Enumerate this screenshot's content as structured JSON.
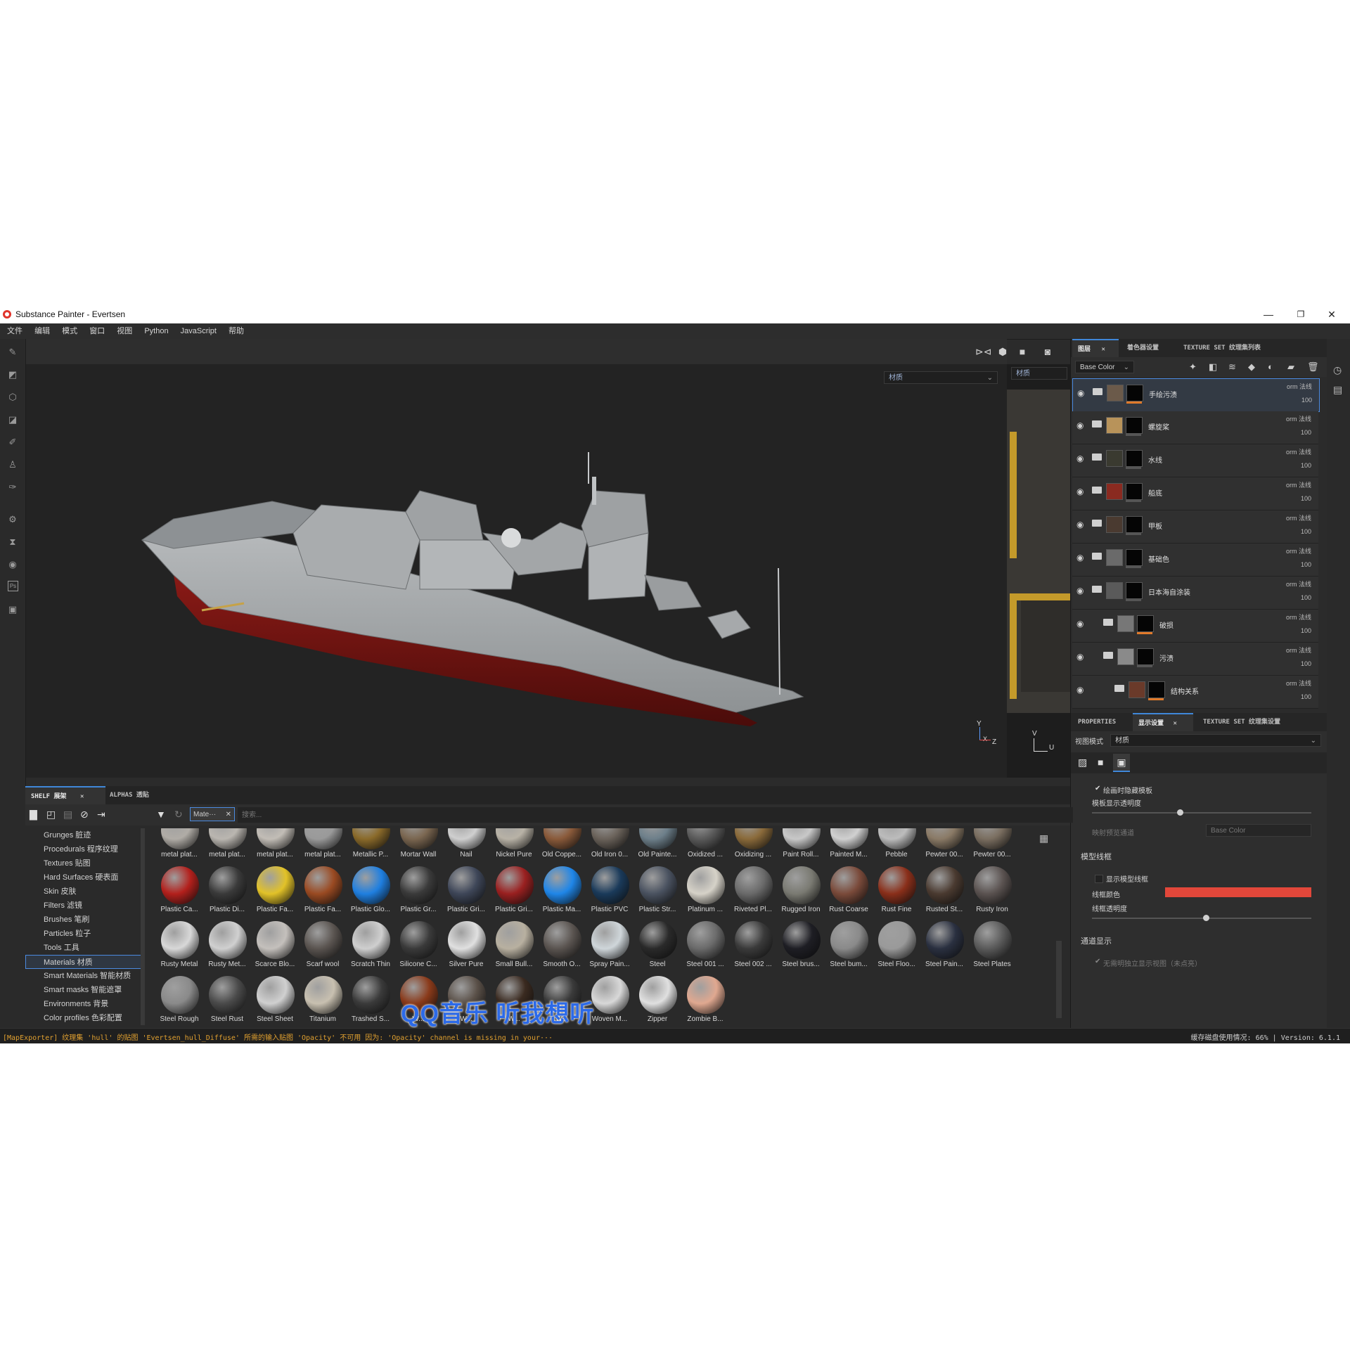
{
  "window": {
    "title": "Substance Painter - Evertsen",
    "minimize": "—",
    "restore": "❐",
    "close": "✕"
  },
  "menu": [
    "文件",
    "编辑",
    "模式",
    "窗口",
    "视图",
    "Python",
    "JavaScript",
    "帮助"
  ],
  "viewport": {
    "material_select": "材质",
    "uv_select": "材质",
    "axis_y": "Y",
    "axis_x": "X",
    "axis_z": "Z",
    "uv_axis_v": "V",
    "uv_axis_u": "U"
  },
  "layers_panel": {
    "tabs": [
      "图层",
      "着色器设置",
      "TEXTURE SET 纹理集列表"
    ],
    "channel_select": "Base Color",
    "layers": [
      {
        "name": "手绘污渍",
        "blend": "orm 法线",
        "opacity": "100",
        "selected": true
      },
      {
        "name": "螺旋桨",
        "blend": "orm 法线",
        "opacity": "100"
      },
      {
        "name": "水线",
        "blend": "orm 法线",
        "opacity": "100"
      },
      {
        "name": "船底",
        "blend": "orm 法线",
        "opacity": "100"
      },
      {
        "name": "甲板",
        "blend": "orm 法线",
        "opacity": "100"
      },
      {
        "name": "基础色",
        "blend": "orm 法线",
        "opacity": "100"
      },
      {
        "name": "日本海自涂装",
        "blend": "orm 法线",
        "opacity": "100"
      },
      {
        "name": "破损",
        "blend": "orm 法线",
        "opacity": "100"
      },
      {
        "name": "污渍",
        "blend": "orm 法线",
        "opacity": "100"
      },
      {
        "name": "结构关系",
        "blend": "orm 法线",
        "opacity": "100"
      }
    ]
  },
  "properties_panel": {
    "tabs": [
      "PROPERTIES",
      "显示设置",
      "TEXTURE SET 纹理集设置"
    ],
    "view_mode_label": "视图模式",
    "view_mode_value": "材质",
    "hide_stencil_label": "绘画时隐藏模板",
    "stencil_opacity_label": "模板显示透明度",
    "stencil_opacity": 0.4,
    "mapping_label": "映射预览通道",
    "mapping_value": "Base Color",
    "wireframe_section": "模型线框",
    "show_wireframe_label": "显示模型线框",
    "wireframe_color_label": "线框颜色",
    "wireframe_color": "#e2473a",
    "wireframe_opacity_label": "线框透明度",
    "wireframe_opacity": 0.52,
    "channel_section": "通道显示",
    "solo_label": "无需明独立显示视图（未点亮）"
  },
  "shelf": {
    "tabs": [
      "SHELF 展架",
      "ALPHAS 透贴"
    ],
    "filter_chip": "Mate···",
    "search_placeholder": "搜索...",
    "categories": [
      "Grunges 脏迹",
      "Procedurals 程序纹理",
      "Textures 贴图",
      "Hard Surfaces 硬表面",
      "Skin 皮肤",
      "Filters 滤镜",
      "Brushes 笔刷",
      "Particles 粒子",
      "Tools 工具",
      "Materials 材质",
      "Smart Materials 智能材质",
      "Smart masks 智能遮罩",
      "Environments 背景",
      "Color profiles 色彩配置"
    ],
    "active_category": "Materials 材质",
    "rows": [
      {
        "items": [
          {
            "label": "metal plat...",
            "color": "#b0aca6"
          },
          {
            "label": "metal plat...",
            "color": "#bab6b0"
          },
          {
            "label": "metal plat...",
            "color": "#c2bdb6"
          },
          {
            "label": "metal plat...",
            "color": "#9a9a9a"
          },
          {
            "label": "Metallic P...",
            "color": "#8a6a2a"
          },
          {
            "label": "Mortar Wall",
            "color": "#7a6650"
          },
          {
            "label": "Nail",
            "color": "#cfcfcf"
          },
          {
            "label": "Nickel Pure",
            "color": "#b8b2a6"
          },
          {
            "label": "Old Coppe...",
            "color": "#8a5a3a"
          },
          {
            "label": "Old Iron 0...",
            "color": "#6a625a"
          },
          {
            "label": "Old Painte...",
            "color": "#6d7f8a"
          },
          {
            "label": "Oxidized ...",
            "color": "#5a5a5a"
          },
          {
            "label": "Oxidizing ...",
            "color": "#8a6a3a"
          },
          {
            "label": "Paint Roll...",
            "color": "#c8c8c8"
          },
          {
            "label": "Painted M...",
            "color": "#d0d0d0"
          },
          {
            "label": "Pebble",
            "color": "#bcbcbc"
          },
          {
            "label": "Pewter 00...",
            "color": "#8a7a66"
          },
          {
            "label": "Pewter 00...",
            "color": "#7a6e60"
          }
        ]
      },
      {
        "items": [
          {
            "label": "Plastic Ca...",
            "color": "#b3201c"
          },
          {
            "label": "Plastic Di...",
            "color": "#3a3a3a"
          },
          {
            "label": "Plastic Fa...",
            "color": "#e2c228"
          },
          {
            "label": "Plastic Fa...",
            "color": "#9a4a22"
          },
          {
            "label": "Plastic Glo...",
            "color": "#1f7fe0"
          },
          {
            "label": "Plastic Gr...",
            "color": "#3a3a3a"
          },
          {
            "label": "Plastic Gri...",
            "color": "#3e4658"
          },
          {
            "label": "Plastic Gri...",
            "color": "#9a2020"
          },
          {
            "label": "Plastic Ma...",
            "color": "#1f86e8"
          },
          {
            "label": "Plastic PVC",
            "color": "#1a3a5a"
          },
          {
            "label": "Plastic Str...",
            "color": "#4a5260"
          },
          {
            "label": "Platinum ...",
            "color": "#d6d2c8"
          },
          {
            "label": "Riveted Pl...",
            "color": "#6a6a6a"
          },
          {
            "label": "Rugged Iron",
            "color": "#7a7a72"
          },
          {
            "label": "Rust Coarse",
            "color": "#7a4a3a"
          },
          {
            "label": "Rust Fine",
            "color": "#8a2f1a"
          },
          {
            "label": "Rusted St...",
            "color": "#4a3a30"
          },
          {
            "label": "Rusty Iron",
            "color": "#5a5250"
          }
        ]
      },
      {
        "items": [
          {
            "label": "Rusty Metal",
            "color": "#d8d8d8"
          },
          {
            "label": "Rusty Met...",
            "color": "#d0d0d0"
          },
          {
            "label": "Scarce Blo...",
            "color": "#c4c0bc"
          },
          {
            "label": "Scarf wool",
            "color": "#5a5450"
          },
          {
            "label": "Scratch Thin",
            "color": "#cfcfcf"
          },
          {
            "label": "Silicone C...",
            "color": "#3a3a3a"
          },
          {
            "label": "Silver Pure",
            "color": "#e0e0e0"
          },
          {
            "label": "Small Bull...",
            "color": "#b8b0a0"
          },
          {
            "label": "Smooth O...",
            "color": "#5a5450"
          },
          {
            "label": "Spray Pain...",
            "color": "#cfd6da"
          },
          {
            "label": "Steel",
            "color": "#2a2a2a"
          },
          {
            "label": "Steel 001 ...",
            "color": "#6a6a6a"
          },
          {
            "label": "Steel 002 ...",
            "color": "#3a3a3a"
          },
          {
            "label": "Steel brus...",
            "color": "#1e1e24"
          },
          {
            "label": "Steel bum...",
            "color": "#8a8a8a"
          },
          {
            "label": "Steel Floo...",
            "color": "#9a9a9a"
          },
          {
            "label": "Steel Pain...",
            "color": "#2a3040"
          },
          {
            "label": "Steel Plates",
            "color": "#5a5a5a"
          }
        ]
      },
      {
        "items": [
          {
            "label": "Steel Rough",
            "color": "#8a8a8a"
          },
          {
            "label": "Steel Rust",
            "color": "#4a4a4a"
          },
          {
            "label": "Steel Sheet",
            "color": "#d0d0d0"
          },
          {
            "label": "Titanium",
            "color": "#c8c0b0"
          },
          {
            "label": "Trashed S...",
            "color": "#3a3a3a"
          },
          {
            "label": "W...",
            "color": "#8a3a1a"
          },
          {
            "label": "W...",
            "color": "#5a5048"
          },
          {
            "label": "W...",
            "color": "#3a2a20"
          },
          {
            "label": "W...",
            "color": "#3a3a3a"
          },
          {
            "label": "Woven M...",
            "color": "#d8d8d8"
          },
          {
            "label": "Zipper",
            "color": "#e0e0e0"
          },
          {
            "label": "Zombie B...",
            "color": "#e0a890"
          }
        ]
      }
    ]
  },
  "status": {
    "error": "[MapExporter] 纹理集 'hull' 的贴图 'Evertsen_hull_Diffuse' 所需的输入贴图 'Opacity' 不可用 因为: 'Opacity' channel is missing in your···",
    "cache_label": "缓存磁盘使用情况:",
    "cache_value": "66%",
    "version": "Version: 6.1.1"
  },
  "watermark": "QQ音乐 听我想听"
}
